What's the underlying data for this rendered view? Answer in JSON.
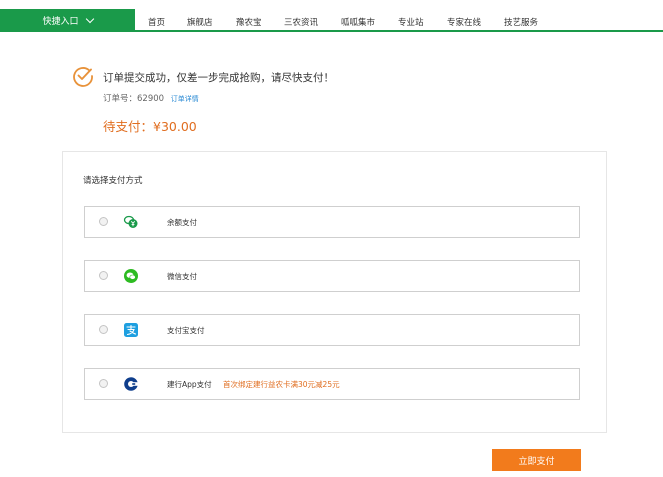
{
  "nav": {
    "quick_entry": "快捷入口",
    "items": [
      "首页",
      "旗舰店",
      "豫农宝",
      "三农资讯",
      "呱呱集市",
      "专业站",
      "专家在线",
      "技艺服务"
    ]
  },
  "order": {
    "success_message": "订单提交成功，仅差一步完成抢购，请尽快支付！",
    "number_label": "订单号：",
    "number": "62900",
    "detail_link": "订单详情",
    "amount_due": "待支付：¥30.00"
  },
  "payment": {
    "title": "请选择支付方式",
    "options": [
      {
        "label": "余额支付",
        "icon": "balance-icon"
      },
      {
        "label": "微信支付",
        "icon": "wechat-icon"
      },
      {
        "label": "支付宝支付",
        "icon": "alipay-icon"
      },
      {
        "label": "建行App支付",
        "icon": "ccb-icon",
        "promo": "首次绑定建行益农卡满30元减25元"
      }
    ],
    "submit_label": "立即支付"
  },
  "colors": {
    "brand_green": "#1a9a4a",
    "accent_orange": "#f27b1c",
    "link_blue": "#2a8ad4"
  }
}
